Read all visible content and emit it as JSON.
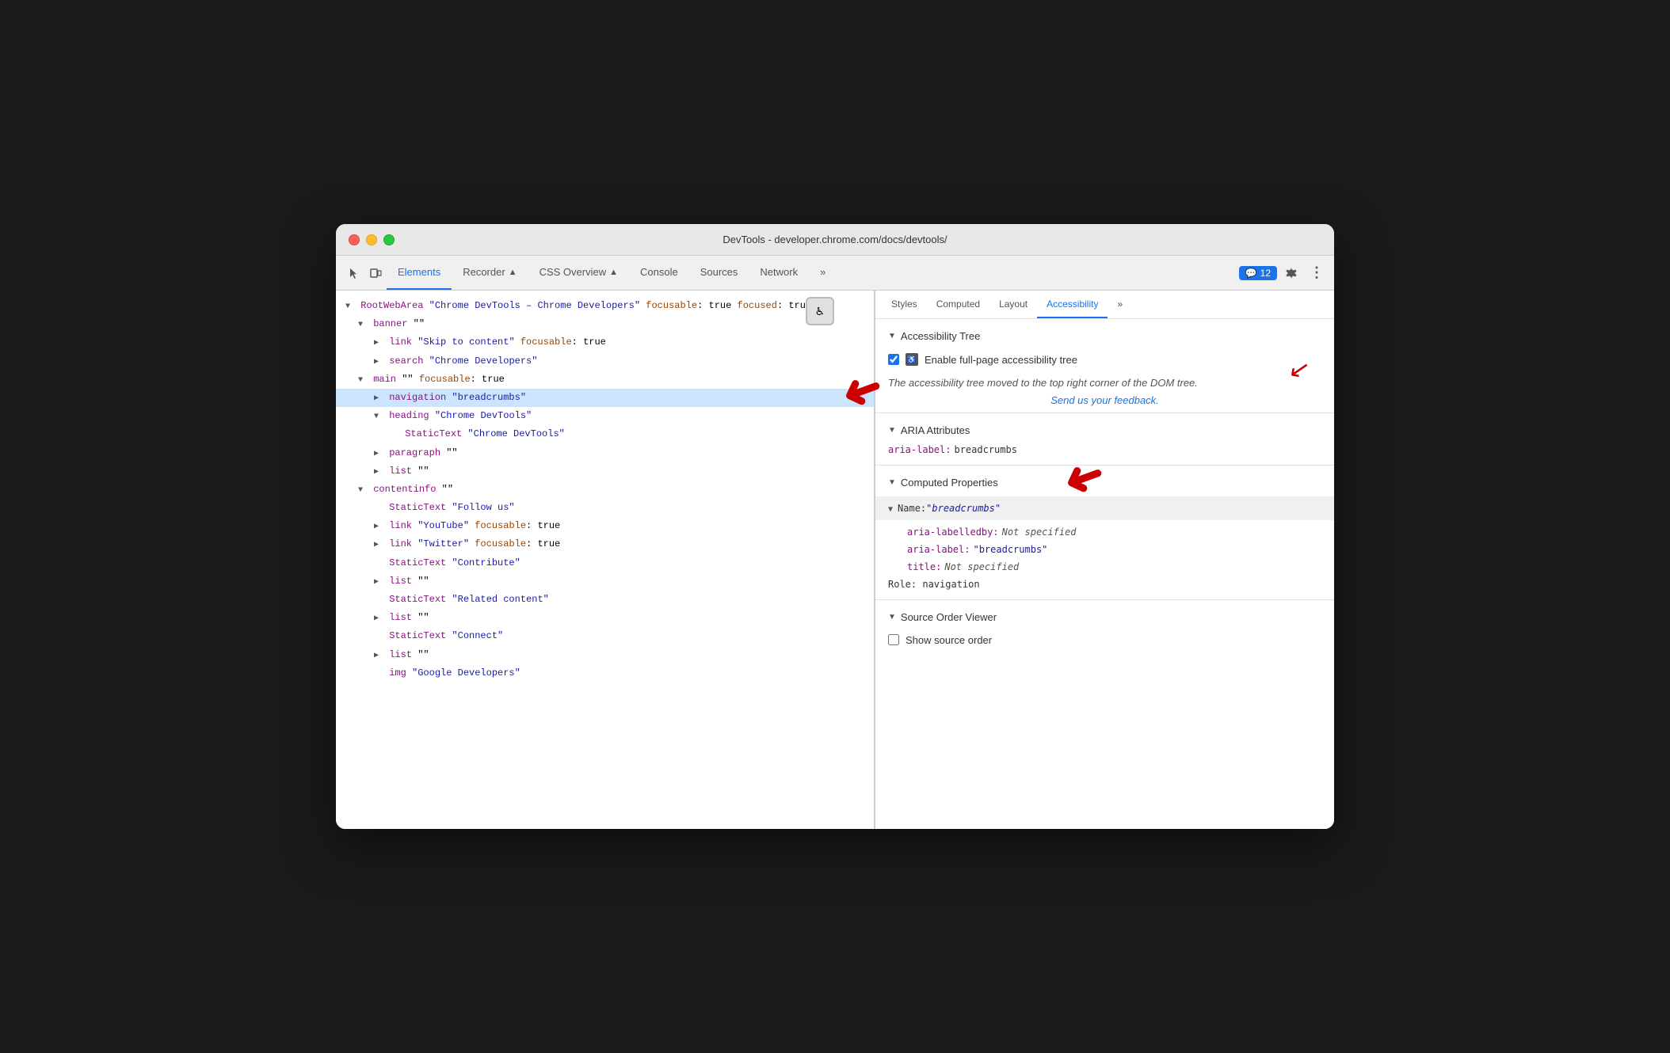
{
  "window": {
    "title": "DevTools - developer.chrome.com/docs/devtools/"
  },
  "devtools": {
    "tabs": [
      {
        "label": "Elements",
        "active": true
      },
      {
        "label": "Recorder",
        "active": false,
        "icon": "▲"
      },
      {
        "label": "CSS Overview",
        "active": false,
        "icon": "▲"
      },
      {
        "label": "Console",
        "active": false
      },
      {
        "label": "Sources",
        "active": false
      },
      {
        "label": "Network",
        "active": false
      },
      {
        "label": "»",
        "active": false
      }
    ],
    "chat_badge": "💬 12",
    "right_tabs": [
      {
        "label": "Styles",
        "active": false
      },
      {
        "label": "Computed",
        "active": false
      },
      {
        "label": "Layout",
        "active": false
      },
      {
        "label": "Accessibility",
        "active": true
      },
      {
        "label": "»",
        "active": false
      }
    ]
  },
  "dom_tree": {
    "lines": [
      {
        "text": "RootWebArea \"Chrome DevTools – Chrome Developers\" focusable: true focused: true",
        "indent": 0,
        "has_arrow": true,
        "arrow_type": "expanded",
        "selected": false
      },
      {
        "text": "banner \"\"",
        "indent": 1,
        "has_arrow": true,
        "arrow_type": "expanded",
        "selected": false
      },
      {
        "text": "link \"Skip to content\" focusable: true",
        "indent": 2,
        "has_arrow": true,
        "arrow_type": "collapsed",
        "selected": false
      },
      {
        "text": "search \"Chrome Developers\"",
        "indent": 2,
        "has_arrow": true,
        "arrow_type": "collapsed",
        "selected": false
      },
      {
        "text": "main \"\" focusable: true",
        "indent": 1,
        "has_arrow": true,
        "arrow_type": "expanded",
        "selected": false
      },
      {
        "text": "navigation \"breadcrumbs\"",
        "indent": 2,
        "has_arrow": true,
        "arrow_type": "collapsed",
        "selected": true
      },
      {
        "text": "heading \"Chrome DevTools\"",
        "indent": 2,
        "has_arrow": true,
        "arrow_type": "expanded",
        "selected": false
      },
      {
        "text": "StaticText \"Chrome DevTools\"",
        "indent": 3,
        "has_arrow": false,
        "arrow_type": "leaf",
        "selected": false
      },
      {
        "text": "paragraph \"\"",
        "indent": 2,
        "has_arrow": true,
        "arrow_type": "collapsed",
        "selected": false
      },
      {
        "text": "list \"\"",
        "indent": 2,
        "has_arrow": true,
        "arrow_type": "collapsed",
        "selected": false
      },
      {
        "text": "contentinfo \"\"",
        "indent": 1,
        "has_arrow": true,
        "arrow_type": "expanded",
        "selected": false
      },
      {
        "text": "StaticText \"Follow us\"",
        "indent": 2,
        "has_arrow": false,
        "arrow_type": "leaf",
        "selected": false
      },
      {
        "text": "link \"YouTube\" focusable: true",
        "indent": 2,
        "has_arrow": true,
        "arrow_type": "collapsed",
        "selected": false
      },
      {
        "text": "link \"Twitter\" focusable: true",
        "indent": 2,
        "has_arrow": true,
        "arrow_type": "collapsed",
        "selected": false
      },
      {
        "text": "StaticText \"Contribute\"",
        "indent": 2,
        "has_arrow": false,
        "arrow_type": "leaf",
        "selected": false
      },
      {
        "text": "list \"\"",
        "indent": 2,
        "has_arrow": true,
        "arrow_type": "collapsed",
        "selected": false
      },
      {
        "text": "StaticText \"Related content\"",
        "indent": 2,
        "has_arrow": false,
        "arrow_type": "leaf",
        "selected": false
      },
      {
        "text": "list \"\"",
        "indent": 2,
        "has_arrow": true,
        "arrow_type": "collapsed",
        "selected": false
      },
      {
        "text": "StaticText \"Connect\"",
        "indent": 2,
        "has_arrow": false,
        "arrow_type": "leaf",
        "selected": false
      },
      {
        "text": "list \"\"",
        "indent": 2,
        "has_arrow": true,
        "arrow_type": "collapsed",
        "selected": false
      },
      {
        "text": "img \"Google Developers\"",
        "indent": 2,
        "has_arrow": false,
        "arrow_type": "leaf",
        "selected": false
      }
    ]
  },
  "accessibility_panel": {
    "tree_section": {
      "title": "Accessibility Tree",
      "enable_label": "Enable full-page accessibility tree",
      "info_text": "The accessibility tree moved to the top right corner of the DOM tree.",
      "feedback_link": "Send us your feedback."
    },
    "aria_section": {
      "title": "ARIA Attributes",
      "rows": [
        {
          "key": "aria-label:",
          "value": "breadcrumbs"
        }
      ]
    },
    "computed_section": {
      "title": "Computed Properties",
      "name_row": "Name: \"breadcrumbs\"",
      "rows": [
        {
          "key": "aria-labelledby:",
          "value": "Not specified"
        },
        {
          "key": "aria-label:",
          "value": "\"breadcrumbs\""
        },
        {
          "key": "title:",
          "value": "Not specified"
        }
      ],
      "role_label": "Role:",
      "role_value": "navigation"
    },
    "source_section": {
      "title": "Source Order Viewer",
      "show_label": "Show source order"
    }
  }
}
